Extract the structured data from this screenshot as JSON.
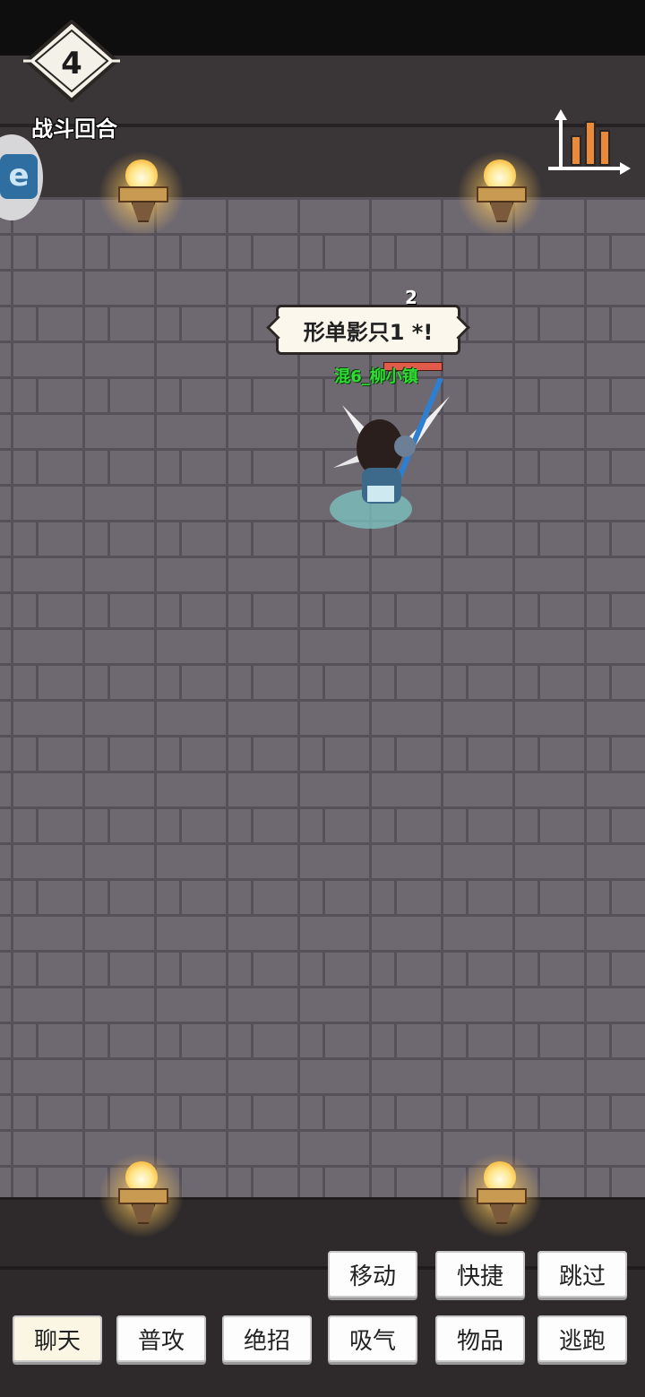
{
  "hud": {
    "round_number": "4",
    "round_label": "战斗回合"
  },
  "battle": {
    "status_text": "形单影只1 *!",
    "stack_count": "2",
    "player_name": "混6_柳小镇",
    "player_hp": 1.0
  },
  "actions": {
    "row1": [
      "移动",
      "快捷",
      "跳过"
    ],
    "row2": [
      "聊天",
      "普攻",
      "绝招",
      "吸气",
      "物品",
      "逃跑"
    ]
  },
  "colors": {
    "floor": "#6e6870",
    "player_name": "#2fdc34",
    "hp": "#e25b4a"
  },
  "icons": [
    "round-counter-icon",
    "stats-chart-icon",
    "side-app-icon",
    "torch-icon"
  ]
}
